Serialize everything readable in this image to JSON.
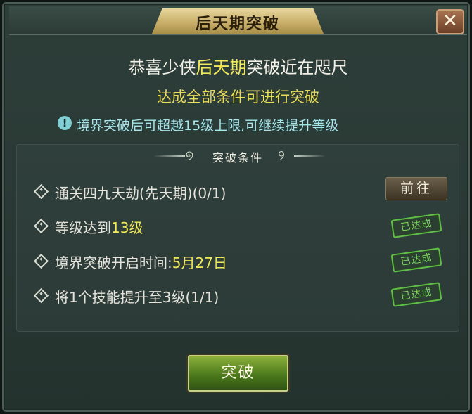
{
  "dialog": {
    "title": "后天期突破",
    "close_label": "✕"
  },
  "header": {
    "line1_prefix": "恭喜少侠",
    "line1_highlight": "后天期",
    "line1_suffix": "突破近在咫尺",
    "line2": "达成全部条件可进行突破",
    "notice_icon": "!",
    "notice": "境界突破后可超越15级上限,可继续提升等级"
  },
  "section": {
    "title": "突破条件"
  },
  "conditions": [
    {
      "text": "通关四九天劫(先天期)(0/1)",
      "action": "前往"
    },
    {
      "text_prefix": "等级达到",
      "text_value": "13级",
      "status": "已达成"
    },
    {
      "text_prefix": "境界突破开启时间:",
      "text_value": "5月27日",
      "status": "已达成"
    },
    {
      "text": "将1个技能提升至3级(1/1)",
      "status": "已达成"
    }
  ],
  "footer": {
    "break_button": "突破"
  }
}
